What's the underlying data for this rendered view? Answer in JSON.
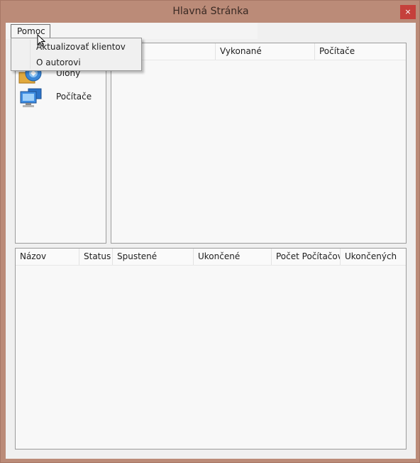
{
  "window": {
    "title": "Hlavná Stránka",
    "close_glyph": "×"
  },
  "menubar": {
    "pomoc": "Pomoc"
  },
  "dropdown": {
    "items": [
      "Aktualizovať klientov",
      "O autorovi"
    ]
  },
  "nav": {
    "items": [
      {
        "label": "Úlohy",
        "icon": "tasks-globe-icon"
      },
      {
        "label": "Počítače",
        "icon": "computers-icon"
      }
    ]
  },
  "upper_table": {
    "columns": [
      "",
      "Vykonané",
      "Počítače"
    ]
  },
  "lower_table": {
    "columns": [
      "Názov",
      "Status",
      "Spustené",
      "Ukončené",
      "Počet Počítačov",
      "Ukončených"
    ]
  },
  "colors": {
    "frame": "#bb8b78",
    "close": "#c5403b",
    "client": "#f0f0f0"
  }
}
